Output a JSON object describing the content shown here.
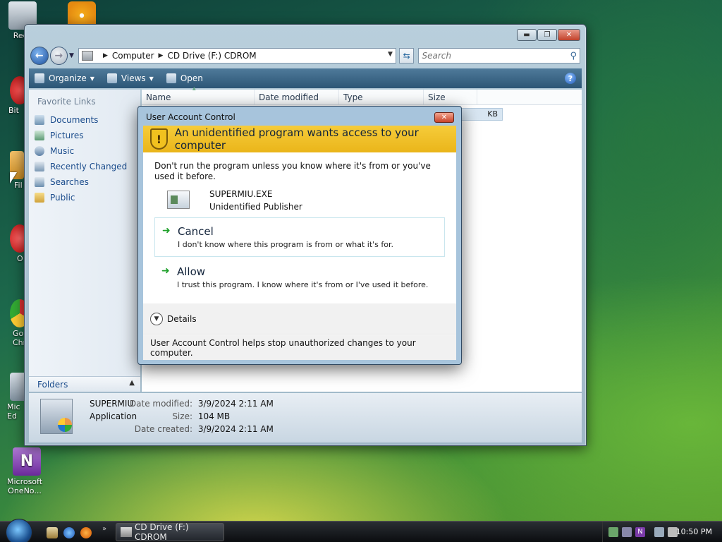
{
  "desktop": {
    "icons": [
      {
        "label": "Recy",
        "name": "recycle-bin-icon"
      },
      {
        "label": "",
        "name": "cd-burner-icon"
      },
      {
        "label": "Bit",
        "name": "bittorrent-icon"
      },
      {
        "label": "Fil",
        "name": "file-shortcut-icon"
      },
      {
        "label": "O",
        "name": "opera-icon"
      },
      {
        "label": "Go Chr",
        "name": "google-chrome-icon"
      },
      {
        "label": "Mic Ed",
        "name": "microsoft-edge-icon"
      },
      {
        "label": "Microsoft OneNo...",
        "name": "onenote-icon"
      }
    ]
  },
  "explorer": {
    "address": {
      "crumbs": [
        "Computer",
        "CD Drive (F:) CDROM"
      ]
    },
    "search": {
      "placeholder": "Search"
    },
    "toolbar": {
      "organize": "Organize",
      "views": "Views",
      "open": "Open"
    },
    "favorites": {
      "title": "Favorite Links",
      "items": [
        "Documents",
        "Pictures",
        "Music",
        "Recently Changed",
        "Searches",
        "Public"
      ]
    },
    "folders_label": "Folders",
    "columns": [
      "Name",
      "Date modified",
      "Type",
      "Size"
    ],
    "row_size_partial": "KB",
    "details": {
      "name": "SUPERMIU",
      "type": "Application",
      "date_modified_label": "Date modified:",
      "date_modified": "3/9/2024 2:11 AM",
      "size_label": "Size:",
      "size": "104 MB",
      "date_created_label": "Date created:",
      "date_created": "3/9/2024 2:11 AM"
    }
  },
  "uac": {
    "title": "User Account Control",
    "heading": "An unidentified program wants access to your computer",
    "warning": "Don't run the program unless you know where it's from or you've used it before.",
    "program_name": "SUPERMIU.EXE",
    "publisher": "Unidentified Publisher",
    "cancel": {
      "title": "Cancel",
      "desc": "I don't know where this program is from or what it's for."
    },
    "allow": {
      "title": "Allow",
      "desc": "I trust this program. I know where it's from or I've used it before."
    },
    "details_label": "Details",
    "footer": "User Account Control helps stop unauthorized changes to your computer."
  },
  "taskbar": {
    "task_label": "CD Drive (F:) CDROM",
    "clock": "10:50 PM"
  },
  "colors": {
    "uac_banner": "#f6cc3a",
    "toolbar": "#2c5676",
    "link": "#1b4c8c"
  }
}
